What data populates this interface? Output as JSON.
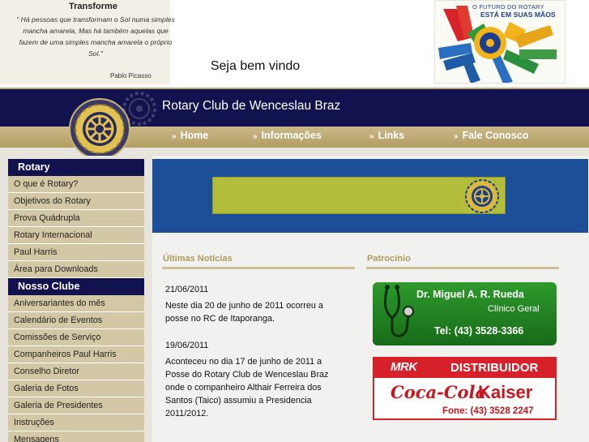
{
  "quote": {
    "title": "Transforme",
    "text": "\" Há pessoas que transformam o Sol numa simples mancha amarela, Mas há também aquelas que fazem de uma simples mancha amarela o próprio Sol.\"",
    "author": "Pablo Picasso"
  },
  "welcome": "Seja bem vindo",
  "rotary_ad": {
    "line1": "O FUTURO DO ROTARY",
    "line2": "ESTÁ EM SUAS MÃOS"
  },
  "header": {
    "title": "Rotary Club de Wenceslau Braz"
  },
  "nav": {
    "marker": "»",
    "items": [
      "Home",
      "Informações",
      "Links",
      "Fale Conosco"
    ]
  },
  "sidebar": {
    "rotary_heading": "Rotary",
    "rotary_items": [
      "O que é Rotary?",
      "Objetivos do Rotary",
      "Prova Quádrupla",
      "Rotary Internacional",
      "Paul Harris",
      "Área para Downloads"
    ],
    "club_heading": "Nosso Clube",
    "club_items": [
      "Aniversariantes do mês",
      "Calendário de Eventos",
      "Comissões de Serviço",
      "Companheiros Paul Harris",
      "Conselho Diretor",
      "Galeria de Fotos",
      "Galeria de Presidentes",
      "Instruções",
      "Mensagens"
    ]
  },
  "news": {
    "heading": "Últimas Notícias",
    "items": [
      {
        "date": "21/06/2011",
        "text": "Neste dia 20 de junho de 2011 ocorreu a posse no RC de Itaporanga."
      },
      {
        "date": "19/06/2011",
        "text": "Aconteceu no dia 17 de junho de 2011 a Posse do Rotary Club de Wenceslau Braz onde o companheiro Althair Ferreira dos Santos (Taico) assumiu a Presidencia 2011/2012."
      }
    ]
  },
  "sponsors": {
    "heading": "Patrocínio",
    "doctor": {
      "name": "Dr. Miguel A. R. Rueda",
      "role": "Clínico Geral",
      "phone": "Tel: (43) 3528-3366"
    },
    "distributor": {
      "brand": "MRK",
      "label": "DISTRIBUIDOR",
      "coke": "Coca-Cola",
      "kaiser": "Kaiser",
      "phone": "Fone: (43) 3528 2247"
    }
  },
  "colors": {
    "navy": "#12124f",
    "gold": "#b29d62",
    "sidebar_item": "#d3c8a5",
    "banner_blue": "#1d4f99",
    "sponsor_green": "#2e9a2c",
    "sponsor_red": "#d6202a"
  }
}
